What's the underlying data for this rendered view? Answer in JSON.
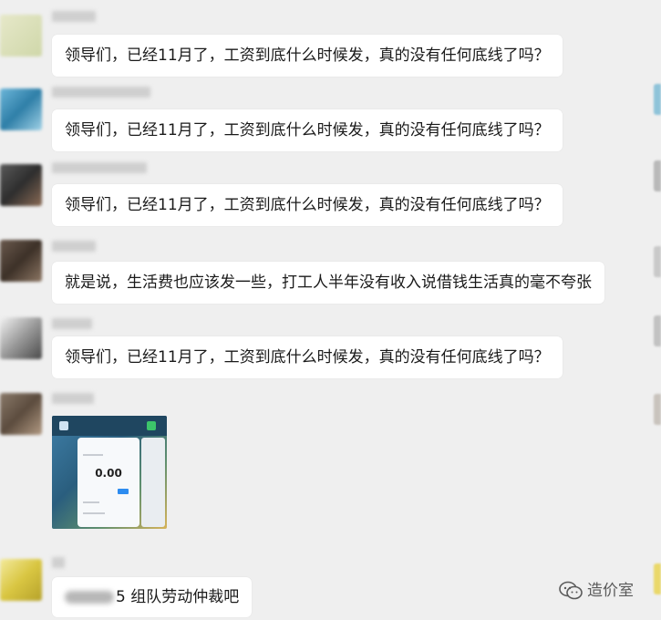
{
  "messages": [
    {
      "type": "text",
      "text": "领导们，已经11月了，工资到底什么时候发，真的没有任何底线了吗？"
    },
    {
      "type": "text",
      "text": "领导们，已经11月了，工资到底什么时候发，真的没有任何底线了吗？"
    },
    {
      "type": "text",
      "text": "领导们，已经11月了，工资到底什么时候发，真的没有任何底线了吗？"
    },
    {
      "type": "text",
      "text": "就是说，生活费也应该发一些，打工人半年没有收入说借钱生活真的毫不夸张"
    },
    {
      "type": "text",
      "text": "领导们，已经11月了，工资到底什么时候发，真的没有任何底线了吗？"
    },
    {
      "type": "image",
      "amount": "0.00"
    },
    {
      "type": "text",
      "text_partial": "5 组队劳动仲裁吧"
    }
  ],
  "watermark": {
    "text": "造价室",
    "icon": "wechat-official-account-icon"
  },
  "colors": {
    "background": "#efefef",
    "bubble": "#ffffff",
    "text": "#1a1a1a"
  }
}
